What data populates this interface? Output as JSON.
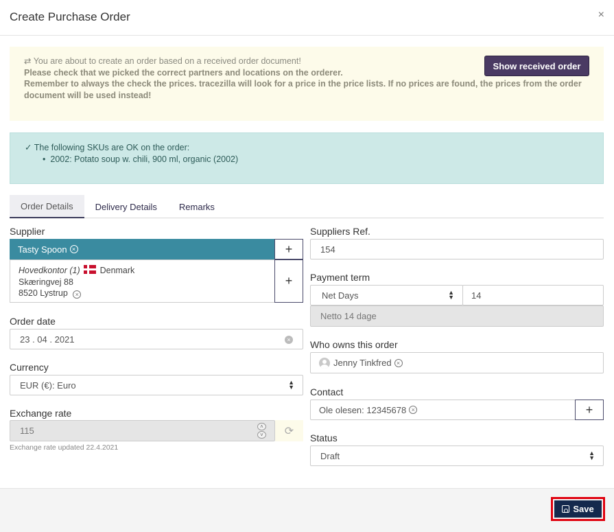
{
  "modal": {
    "title": "Create Purchase Order",
    "close": "×"
  },
  "notice": {
    "line1": "You are about to create an order based on a received order document!",
    "line2": "Please check that we picked the correct partners and locations on the orderer.",
    "line3": "Remember to always the check the prices. tracezilla will look for a price in the price lists. If no prices are found, the prices from the order document will be used instead!",
    "button": "Show received order"
  },
  "sku_ok": {
    "title": "The following SKUs are OK on the order:",
    "items": [
      "2002: Potato soup w. chili, 900 ml, organic (2002)"
    ]
  },
  "tabs": [
    "Order Details",
    "Delivery Details",
    "Remarks"
  ],
  "form": {
    "supplier": {
      "label": "Supplier",
      "value": "Tasty Spoon",
      "address": {
        "name": "Hovedkontor (1)",
        "country": "Denmark",
        "street": "Skæringvej 88",
        "city": "8520 Lystrup"
      }
    },
    "order_date": {
      "label": "Order date",
      "value": "23 . 04 . 2021"
    },
    "currency": {
      "label": "Currency",
      "value": "EUR (€): Euro"
    },
    "exchange_rate": {
      "label": "Exchange rate",
      "value": "115",
      "note": "Exchange rate updated 22.4.2021"
    },
    "suppliers_ref": {
      "label": "Suppliers Ref.",
      "value": "154"
    },
    "payment_term": {
      "label": "Payment term",
      "type": "Net Days",
      "days": "14",
      "description": "Netto 14 dage"
    },
    "owner": {
      "label": "Who owns this order",
      "value": "Jenny Tinkfred"
    },
    "contact": {
      "label": "Contact",
      "value": "Ole olesen: 12345678"
    },
    "status": {
      "label": "Status",
      "value": "Draft"
    }
  },
  "footer": {
    "save_label": "Save"
  },
  "colors": {
    "supplier_tag": "#3a8ba0",
    "primary_button": "#4a3a63",
    "save_button": "#14294d",
    "highlight": "#e0000e"
  }
}
